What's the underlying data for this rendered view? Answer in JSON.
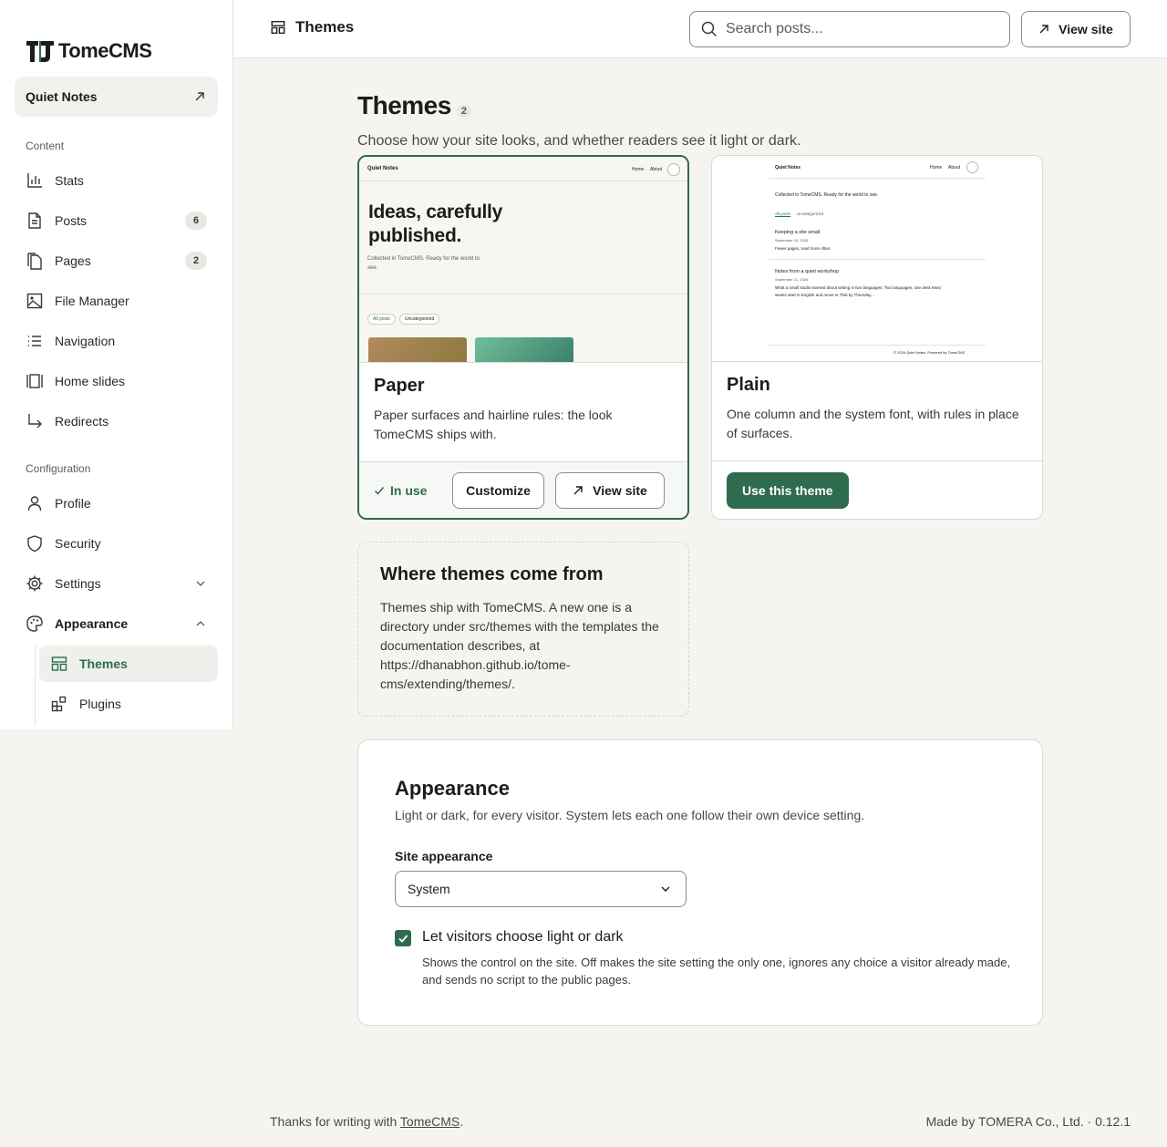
{
  "brand": {
    "name": "TomeCMS"
  },
  "site_switcher": {
    "label": "Quiet Notes"
  },
  "sidebar": {
    "content_heading": "Content",
    "content_items": [
      {
        "label": "Stats",
        "icon": "bar-chart-icon"
      },
      {
        "label": "Posts",
        "icon": "document-icon",
        "badge": "6"
      },
      {
        "label": "Pages",
        "icon": "pages-icon",
        "badge": "2"
      },
      {
        "label": "File Manager",
        "icon": "image-icon"
      },
      {
        "label": "Navigation",
        "icon": "list-icon"
      },
      {
        "label": "Home slides",
        "icon": "slides-icon"
      },
      {
        "label": "Redirects",
        "icon": "redirect-arrow-icon"
      }
    ],
    "config_heading": "Configuration",
    "config_items": [
      {
        "label": "Profile",
        "icon": "user-icon"
      },
      {
        "label": "Security",
        "icon": "shield-icon"
      },
      {
        "label": "Settings",
        "icon": "gear-icon"
      },
      {
        "label": "Appearance",
        "icon": "palette-icon"
      }
    ],
    "appearance_sub": [
      {
        "label": "Themes",
        "icon": "layout-icon",
        "active": true
      },
      {
        "label": "Plugins",
        "icon": "plugin-blocks-icon"
      }
    ]
  },
  "topbar": {
    "title": "Themes",
    "search_placeholder": "Search posts...",
    "view_site": "View site"
  },
  "page": {
    "title": "Themes",
    "count": "2",
    "subtitle": "Choose how your site looks, and whether readers see it light or dark."
  },
  "themes": [
    {
      "name": "Paper",
      "description": "Paper surfaces and hairline rules: the look TomeCMS ships with.",
      "status": "In use",
      "customize": "Customize",
      "view_site": "View site",
      "preview": {
        "site": "Quiet Notes",
        "nav": [
          "Home",
          "About"
        ],
        "headline_1": "Ideas, carefully",
        "headline_2": "published.",
        "tagline_1": "Collected in TomeCMS. Ready for the world to",
        "tagline_2": "see.",
        "chips": [
          "All posts",
          "Uncategorized"
        ]
      }
    },
    {
      "name": "Plain",
      "description": "One column and the system font, with rules in place of surfaces.",
      "action": "Use this theme",
      "preview": {
        "site": "Quiet Notes",
        "nav": [
          "Home",
          "About"
        ],
        "tagline": "Collected in TomeCMS. Ready for the world to see.",
        "filters": [
          "All posts",
          "Uncategorized"
        ],
        "post1_title": "Keeping a site small",
        "post1_date": "September 24, 2026",
        "post1_excerpt": "Fewer pages, read more often.",
        "post2_title": "Notes from a quiet workshop",
        "post2_date": "September 21, 2026",
        "post2_excerpt_1": "What a small studio learned about writing in two languages. Two languages, one desk Most",
        "post2_excerpt_2": "weeks start in English and move to Thai by Thursday...",
        "footer": "© 2026 Quiet Notes. Powered by TomeCMS"
      }
    }
  ],
  "info": {
    "title": "Where themes come from",
    "body": "Themes ship with TomeCMS. A new one is a directory under src/themes with the templates the documentation describes, at https://dhanabhon.github.io/tome-cms/extending/themes/."
  },
  "appearance": {
    "title": "Appearance",
    "description": "Light or dark, for every visitor. System lets each one follow their own device setting.",
    "field_label": "Site appearance",
    "selected": "System",
    "checkbox_label": "Let visitors choose light or dark",
    "checkbox_checked": true,
    "checkbox_help": "Shows the control on the site. Off makes the site setting the only one, ignores any choice a visitor already made, and sends no script to the public pages."
  },
  "footer": {
    "left_prefix": "Thanks for writing with ",
    "left_link": "TomeCMS",
    "left_suffix": ".",
    "right": "Made by TOMERA Co., Ltd. · 0.12.1"
  },
  "colors": {
    "accent": "#2e6b4f",
    "background": "#f5f4f1"
  }
}
